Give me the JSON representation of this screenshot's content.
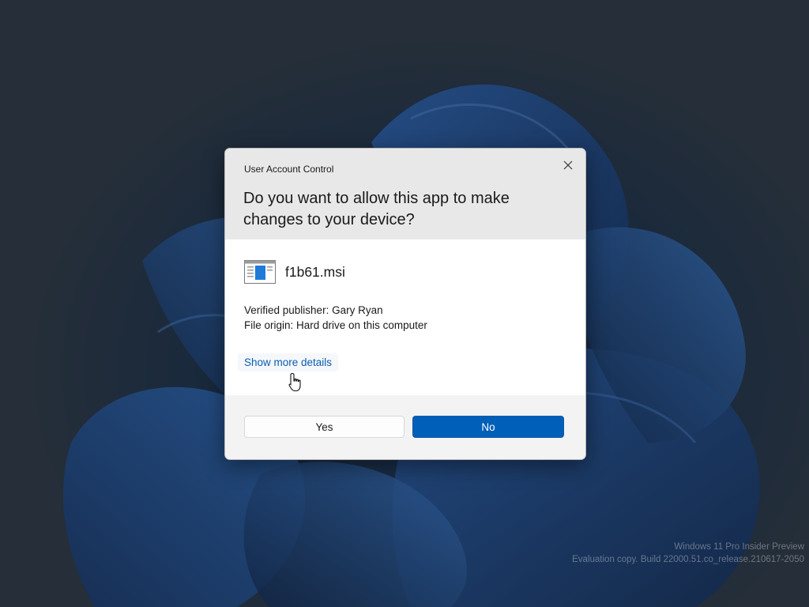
{
  "watermark": {
    "line1": "Windows 11 Pro Insider Preview",
    "line2": "Evaluation copy. Build 22000.51.co_release.210617-2050"
  },
  "uac": {
    "caption": "User Account Control",
    "question": "Do you want to allow this app to make changes to your device?",
    "app_name": "f1b61.msi",
    "publisher": "Verified publisher: Gary Ryan",
    "origin": "File origin: Hard drive on this computer",
    "details_link": "Show more details",
    "yes_label": "Yes",
    "no_label": "No"
  },
  "icons": {
    "close": "close-icon",
    "app": "installer-app-icon",
    "cursor": "hand-pointer-cursor"
  },
  "colors": {
    "accent": "#005fb8",
    "link": "#0a5eb0",
    "header_bg": "#e8e8e8",
    "footer_bg": "#f3f3f3"
  }
}
